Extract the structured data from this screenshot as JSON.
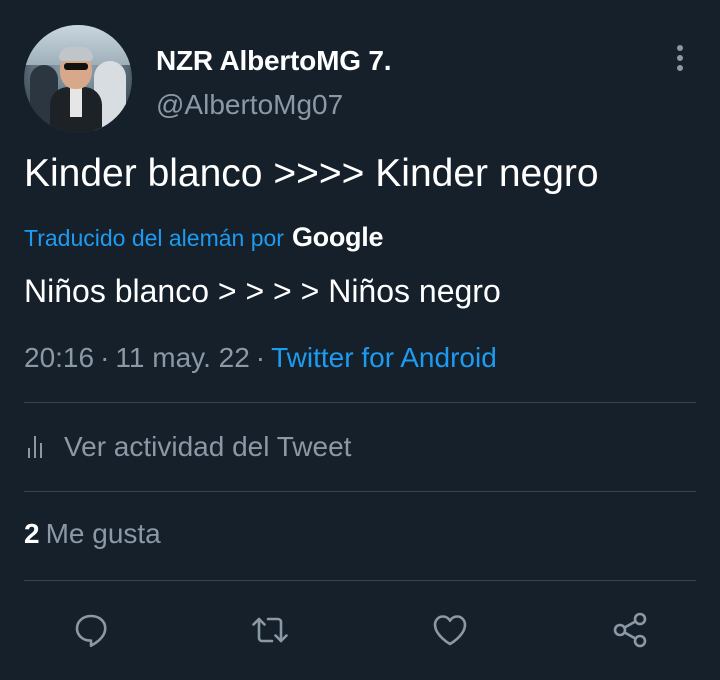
{
  "tweet": {
    "author": {
      "display_name": "NZR AlbertoMG 7.",
      "handle": "@AlbertoMg07"
    },
    "text": "Kinder blanco >>>> Kinder negro",
    "translation": {
      "label": "Traducido del alemán por",
      "provider": "Google",
      "text": "Niños blanco > > > > Niños negro"
    },
    "time": "20:16",
    "date": "11 may. 22",
    "separator": "·",
    "source": "Twitter for Android",
    "activity_label": "Ver actividad del Tweet",
    "likes": {
      "count": "2",
      "label": "Me gusta"
    }
  },
  "icons": {
    "more": "more-vertical-icon",
    "activity": "analytics-bars-icon",
    "reply": "reply-icon",
    "retweet": "retweet-icon",
    "like": "heart-icon",
    "share": "share-icon"
  },
  "colors": {
    "background": "#15202b",
    "text_primary": "#ffffff",
    "text_secondary": "#8b98a5",
    "accent": "#1d9bf0",
    "divider": "#38444d"
  }
}
